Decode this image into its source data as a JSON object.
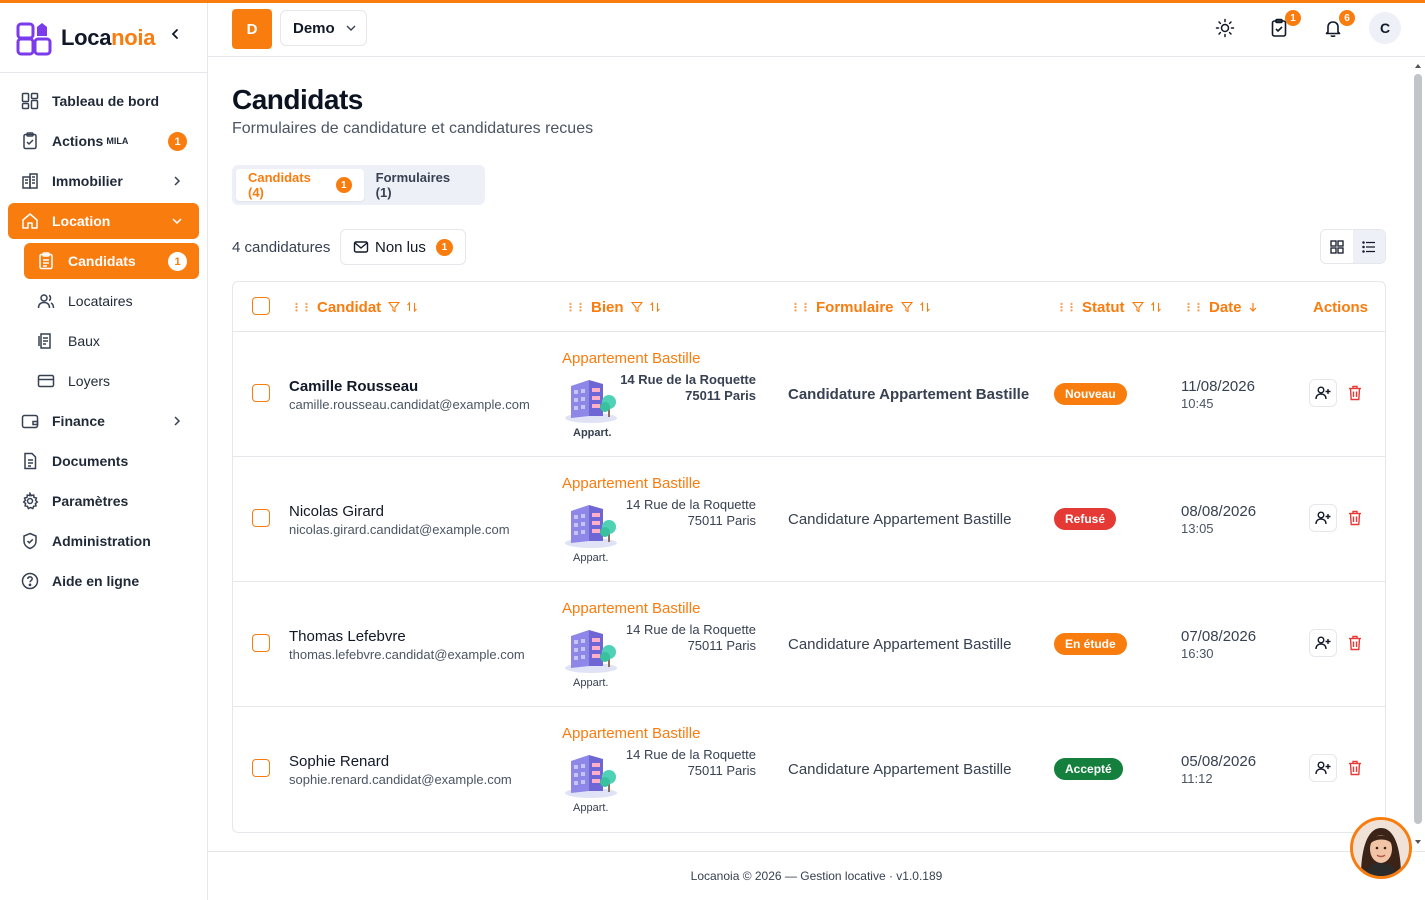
{
  "app": {
    "logo_part1": "Loca",
    "logo_part2": "noia",
    "collapse_icon": "chevron-left-icon"
  },
  "sidebar": {
    "items": [
      {
        "label": "Tableau de bord",
        "icon": "dashboard-icon"
      },
      {
        "label": "Actions",
        "sup": "MILA",
        "badge": "1",
        "icon": "clipboard-check-icon"
      },
      {
        "label": "Immobilier",
        "icon": "building-icon"
      },
      {
        "label": "Location",
        "icon": "home-icon"
      },
      {
        "label": "Candidats",
        "badge": "1",
        "icon": "clipboard-list-icon"
      },
      {
        "label": "Locataires",
        "icon": "users-icon"
      },
      {
        "label": "Baux",
        "icon": "contract-icon"
      },
      {
        "label": "Loyers",
        "icon": "credit-card-icon"
      },
      {
        "label": "Finance",
        "icon": "wallet-icon"
      },
      {
        "label": "Documents",
        "icon": "document-icon"
      },
      {
        "label": "Paramètres",
        "icon": "gear-icon"
      },
      {
        "label": "Administration",
        "icon": "shield-icon"
      },
      {
        "label": "Aide en ligne",
        "icon": "help-icon"
      }
    ]
  },
  "header": {
    "org_initial": "D",
    "org_name": "Demo",
    "tasks_badge": "1",
    "notifications_badge": "6",
    "user_initial": "C"
  },
  "page": {
    "title": "Candidats",
    "subtitle": "Formulaires de candidature et candidatures recues",
    "tabs": [
      {
        "label": "Candidats (4)",
        "badge": "1"
      },
      {
        "label": "Formulaires (1)"
      }
    ],
    "count_label": "4 candidatures",
    "unread_label": "Non lus",
    "unread_badge": "1"
  },
  "table": {
    "columns": [
      "Candidat",
      "Bien",
      "Formulaire",
      "Statut",
      "Date",
      "Actions"
    ],
    "rows": [
      {
        "name": "Camille Rousseau",
        "email": "camille.rousseau.candidat@example.com",
        "property": "Appartement Bastille",
        "address1": "14 Rue de la Roquette",
        "address2": "75011 Paris",
        "type": "Appart.",
        "form": "Candidature Appartement Bastille",
        "status": "Nouveau",
        "status_color": "#f97c0f",
        "date": "11/08/2026",
        "time": "10:45",
        "unread": true
      },
      {
        "name": "Nicolas Girard",
        "email": "nicolas.girard.candidat@example.com",
        "property": "Appartement Bastille",
        "address1": "14 Rue de la Roquette",
        "address2": "75011 Paris",
        "type": "Appart.",
        "form": "Candidature Appartement Bastille",
        "status": "Refusé",
        "status_color": "#e53935",
        "date": "08/08/2026",
        "time": "13:05",
        "unread": false
      },
      {
        "name": "Thomas Lefebvre",
        "email": "thomas.lefebvre.candidat@example.com",
        "property": "Appartement Bastille",
        "address1": "14 Rue de la Roquette",
        "address2": "75011 Paris",
        "type": "Appart.",
        "form": "Candidature Appartement Bastille",
        "status": "En étude",
        "status_color": "#f97c0f",
        "date": "07/08/2026",
        "time": "16:30",
        "unread": false
      },
      {
        "name": "Sophie Renard",
        "email": "sophie.renard.candidat@example.com",
        "property": "Appartement Bastille",
        "address1": "14 Rue de la Roquette",
        "address2": "75011 Paris",
        "type": "Appart.",
        "form": "Candidature Appartement Bastille",
        "status": "Accepté",
        "status_color": "#15803d",
        "date": "05/08/2026",
        "time": "11:12",
        "unread": false
      }
    ]
  },
  "footer": {
    "text": "Locanoia © 2026 — Gestion locative · v1.0.189"
  },
  "colors": {
    "accent": "#f97c0f",
    "danger": "#e53935",
    "success": "#15803d"
  }
}
